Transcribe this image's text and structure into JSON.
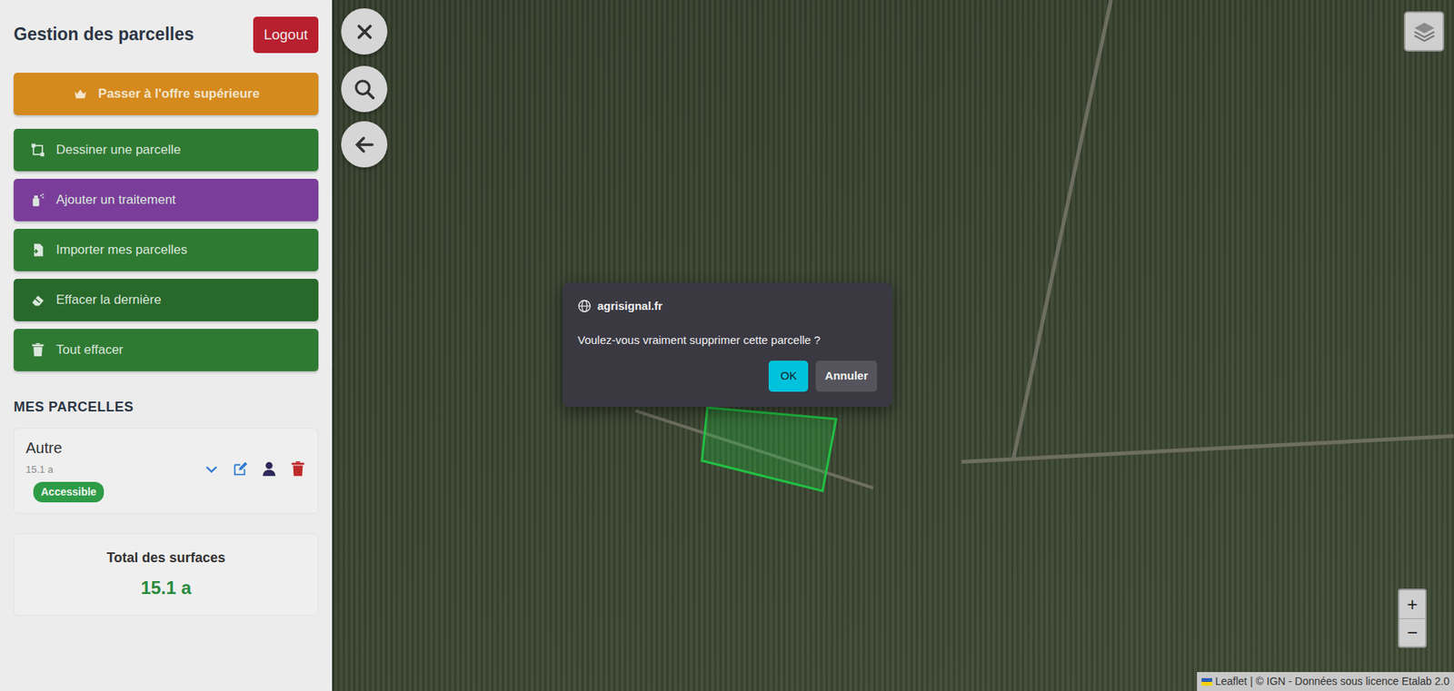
{
  "sidebar": {
    "title": "Gestion des parcelles",
    "logout": "Logout",
    "upgrade": "Passer à l'offre supérieure",
    "actions": [
      {
        "label": "Dessiner une parcelle",
        "color": "#2f7a33"
      },
      {
        "label": "Ajouter un traitement",
        "color": "#7a3e9a"
      },
      {
        "label": "Importer mes parcelles",
        "color": "#2f7a33"
      },
      {
        "label": "Effacer la dernière",
        "color": "#28692b"
      },
      {
        "label": "Tout effacer",
        "color": "#2f7a33"
      }
    ],
    "section_title": "MES PARCELLES",
    "parcels": [
      {
        "name": "Autre",
        "area": "15.1 a",
        "status": "Accessible",
        "expanded": false
      }
    ],
    "total": {
      "label": "Total des surfaces",
      "value": "15.1 a"
    }
  },
  "map": {
    "zoom_in": "+",
    "zoom_out": "−",
    "attribution": {
      "link": "Leaflet",
      "text": "| © IGN - Données sous licence Etalab 2.0"
    }
  },
  "dialog": {
    "origin": "agrisignal.fr",
    "message": "Voulez-vous vraiment supprimer cette parcelle ?",
    "buttons": [
      {
        "label": "OK",
        "selected": true
      },
      {
        "label": "Annuler",
        "selected": false
      }
    ]
  }
}
